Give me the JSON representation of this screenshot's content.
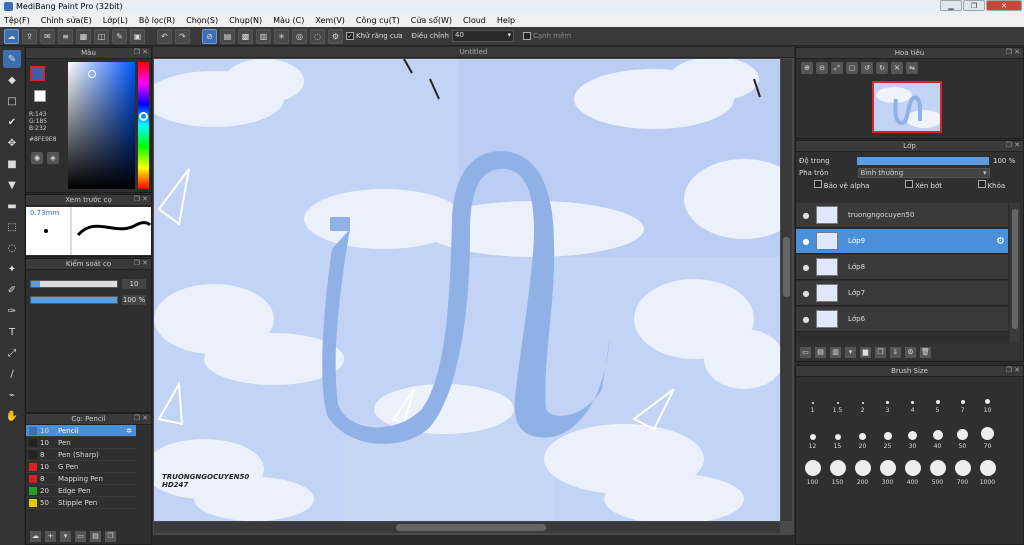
{
  "app": {
    "title": "MediBang Paint Pro (32bit)"
  },
  "menu": [
    "Tệp(F)",
    "Chỉnh sửa(E)",
    "Lớp(L)",
    "Bộ lọc(R)",
    "Chọn(S)",
    "Chụp(N)",
    "Màu (C)",
    "Xem(V)",
    "Công cụ(T)",
    "Cửa sổ(W)",
    "Cloud",
    "Help"
  ],
  "toolbar": {
    "antialias_label": "Khử răng cưa",
    "correction_label": "Điều chỉnh",
    "correction_value": "40",
    "edge_label": "Cạnh mềm"
  },
  "color_panel": {
    "title": "Màu",
    "r": "R:143",
    "g": "G:185",
    "b": "B:232",
    "hex": "#8FE9E8",
    "accent": "#3b5fa8"
  },
  "preview_panel": {
    "title": "Xem trước cọ",
    "size": "0.73mm"
  },
  "brush_control": {
    "title": "Kiểm soát cọ",
    "size_value": "10",
    "size_fraction": 0.1,
    "opacity_value": "100 %",
    "opacity_fraction": 1.0
  },
  "tool_list": {
    "title": "Cọ: Pencil",
    "items": [
      {
        "size": "10",
        "name": "Pencil",
        "color": "#3d6fb0",
        "selected": true
      },
      {
        "size": "10",
        "name": "Pen",
        "color": "#222222"
      },
      {
        "size": "8",
        "name": "Pen (Sharp)",
        "color": "#222222"
      },
      {
        "size": "10",
        "name": "G Pen",
        "color": "#d22222"
      },
      {
        "size": "8",
        "name": "Mapping Pen",
        "color": "#d22222"
      },
      {
        "size": "20",
        "name": "Edge Pen",
        "color": "#22a022"
      },
      {
        "size": "50",
        "name": "Stipple Pen",
        "color": "#e0d000"
      }
    ]
  },
  "canvas": {
    "tab_title": "Untitled",
    "watermark_line1": "TRUONGNGOCUYEN50",
    "watermark_line2": "HD247"
  },
  "navigator": {
    "title": "Hoa tiêu"
  },
  "layers": {
    "title": "Lớp",
    "opacity_label": "Độ trong",
    "opacity_value": "100 %",
    "opacity_fraction": 1.0,
    "blend_label": "Pha trộn",
    "blend_value": "Bình thường",
    "protect_alpha": "Bảo vệ alpha",
    "clipping": "Xén bớt",
    "lock": "Khóa",
    "items": [
      {
        "name": "truongngocuyen50",
        "selected": false
      },
      {
        "name": "Lớp9",
        "selected": true
      },
      {
        "name": "Lớp8",
        "selected": false
      },
      {
        "name": "Lớp7",
        "selected": false
      },
      {
        "name": "Lớp6",
        "selected": false
      }
    ]
  },
  "brush_size": {
    "title": "Brush Size",
    "sizes": [
      "1",
      "1.5",
      "2",
      "3",
      "4",
      "5",
      "7",
      "10",
      "12",
      "15",
      "20",
      "25",
      "30",
      "40",
      "50",
      "70",
      "100",
      "150",
      "200",
      "300",
      "400",
      "500",
      "700",
      "1000"
    ]
  }
}
